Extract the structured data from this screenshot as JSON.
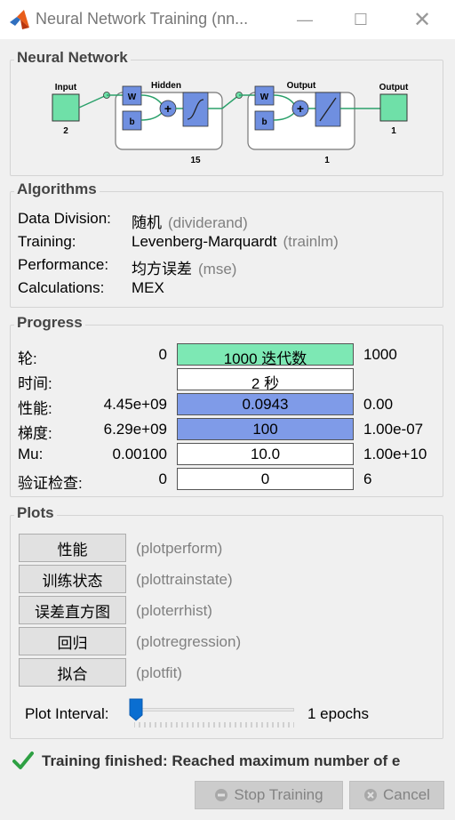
{
  "window": {
    "title": "Neural Network Training (nn...",
    "minimize_glyph": "—",
    "maximize_glyph": "☐",
    "close_glyph": "✕",
    "icon": "matlab-icon"
  },
  "network": {
    "section_title": "Neural Network",
    "input_label": "Input",
    "input_size": "2",
    "hidden_label": "Hidden",
    "hidden_size": "15",
    "output_layer_label": "Output",
    "output_layer_size": "1",
    "output_label": "Output",
    "output_size": "1",
    "weight_label": "W",
    "bias_label": "b",
    "sum_glyph": "+"
  },
  "algorithms": {
    "section_title": "Algorithms",
    "rows": [
      {
        "label": "Data Division:",
        "value": "随机",
        "func": "(dividerand)"
      },
      {
        "label": "Training:",
        "value": "Levenberg-Marquardt",
        "func": "(trainlm)"
      },
      {
        "label": "Performance:",
        "value": "均方误差",
        "func": "(mse)"
      },
      {
        "label": "Calculations:",
        "value": "MEX",
        "func": ""
      }
    ]
  },
  "progress": {
    "section_title": "Progress",
    "rows": [
      {
        "label": "轮:",
        "start": "0",
        "current": "1000 迭代数",
        "end": "1000",
        "fill": 1.0,
        "fill_color": "#7de8b4"
      },
      {
        "label": "时间:",
        "start": "",
        "current": "2 秒",
        "end": "",
        "fill": 0.0,
        "fill_color": "#ffffff"
      },
      {
        "label": "性能:",
        "start": "4.45e+09",
        "current": "0.0943",
        "end": "0.00",
        "fill": 1.0,
        "fill_color": "#7f9be8"
      },
      {
        "label": "梯度:",
        "start": "6.29e+09",
        "current": "100",
        "end": "1.00e-07",
        "fill": 1.0,
        "fill_color": "#7f9be8"
      },
      {
        "label": "Mu:",
        "start": "0.00100",
        "current": "10.0",
        "end": "1.00e+10",
        "fill": 0.0,
        "fill_color": "#ffffff"
      },
      {
        "label": "验证检查:",
        "start": "0",
        "current": "0",
        "end": "6",
        "fill": 0.0,
        "fill_color": "#ffffff"
      }
    ]
  },
  "plots": {
    "section_title": "Plots",
    "buttons": [
      {
        "label": "性能",
        "func": "(plotperform)"
      },
      {
        "label": "训练状态",
        "func": "(plottrainstate)"
      },
      {
        "label": "误差直方图",
        "func": "(ploterrhist)"
      },
      {
        "label": "回归",
        "func": "(plotregression)"
      },
      {
        "label": "拟合",
        "func": "(plotfit)"
      }
    ],
    "interval_label": "Plot Interval:",
    "interval_value": "1 epochs",
    "slider_level": 0.0
  },
  "status": {
    "icon": "checkmark-icon",
    "text": "Training finished: Reached maximum number of e"
  },
  "actions": {
    "stop_label": "Stop Training",
    "cancel_label": "Cancel"
  },
  "colors": {
    "epoch_fill": "#7de8b4",
    "perf_fill": "#7f9be8",
    "layer_green": "#6fe0a8",
    "weight_blue": "#6f8fe0",
    "status_green": "#2ea043"
  }
}
